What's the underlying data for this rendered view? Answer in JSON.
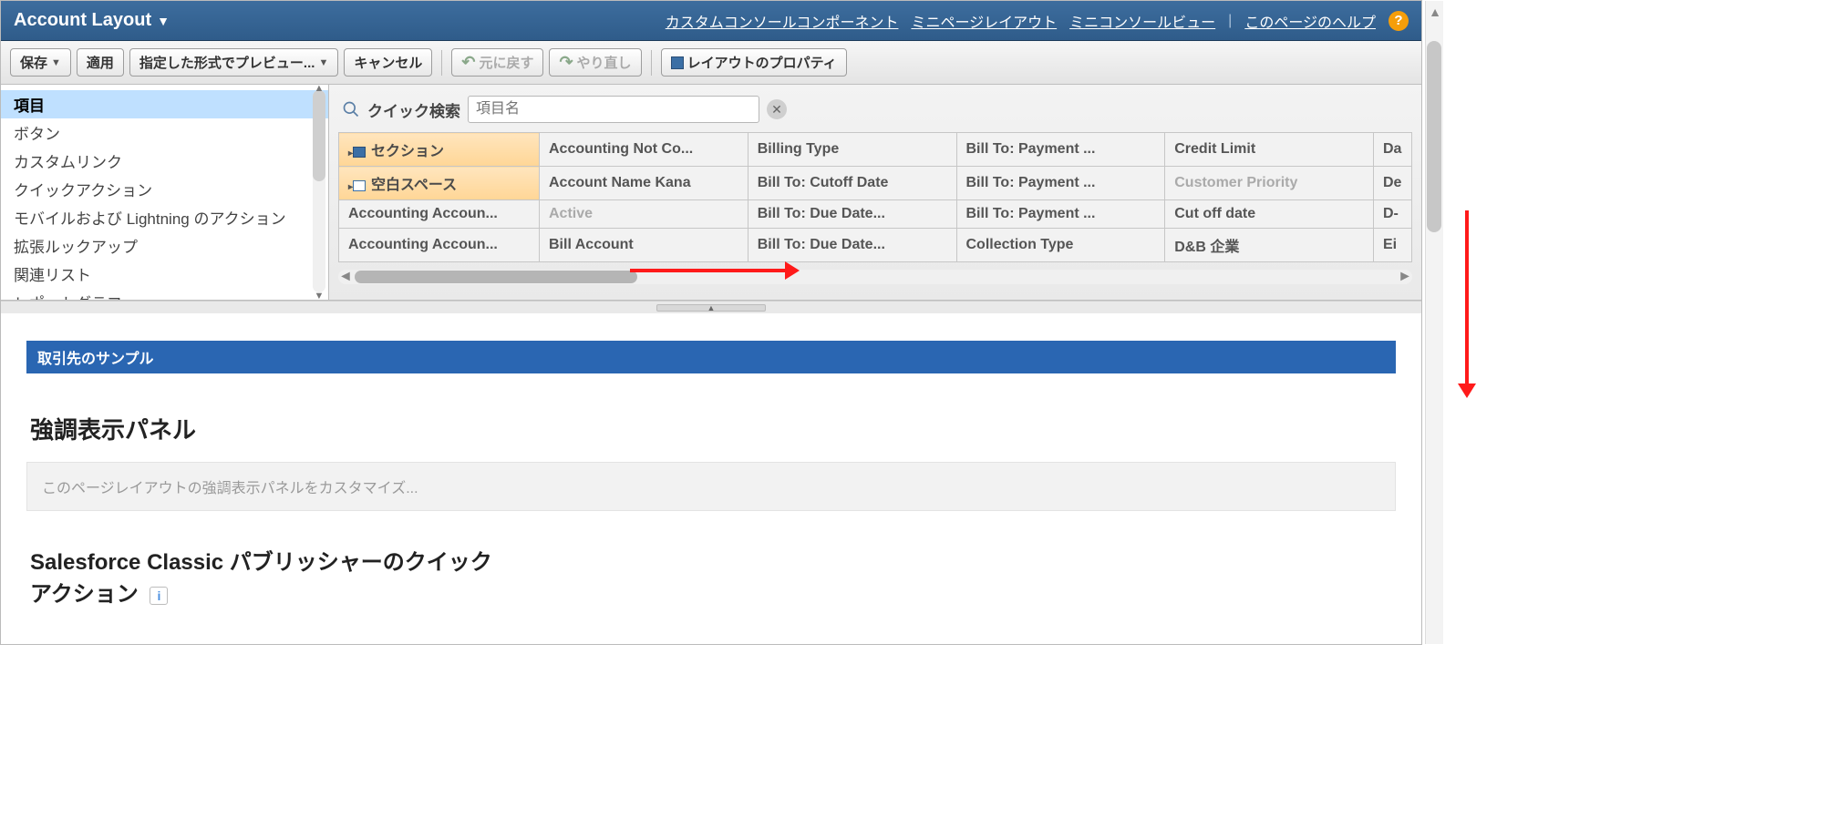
{
  "header": {
    "title": "Account Layout",
    "links": {
      "customConsole": "カスタムコンソールコンポーネント",
      "miniPageLayout": "ミニページレイアウト",
      "miniConsoleView": "ミニコンソールビュー",
      "help": "このページのヘルプ"
    }
  },
  "toolbar": {
    "save": "保存",
    "apply": "適用",
    "previewAs": "指定した形式でプレビュー...",
    "cancel": "キャンセル",
    "undo": "元に戻す",
    "redo": "やり直し",
    "layoutProps": "レイアウトのプロパティ"
  },
  "sidebar": {
    "items": [
      "項目",
      "ボタン",
      "カスタムリンク",
      "クイックアクション",
      "モバイルおよび Lightning のアクション",
      "拡張ルックアップ",
      "関連リスト",
      "レポートグラフ"
    ],
    "selectedIndex": 0
  },
  "search": {
    "label": "クイック検索",
    "placeholder": "項目名"
  },
  "palette": {
    "rows": [
      [
        {
          "label": "セクション",
          "style": "orange",
          "icon": "sec"
        },
        {
          "label": "Accounting Not Co..."
        },
        {
          "label": "Billing Type"
        },
        {
          "label": "Bill To: Payment ..."
        },
        {
          "label": "Credit Limit"
        },
        {
          "label": "Da"
        }
      ],
      [
        {
          "label": "空白スペース",
          "style": "orange",
          "icon": "blank"
        },
        {
          "label": "Account Name Kana"
        },
        {
          "label": "Bill To: Cutoff Date"
        },
        {
          "label": "Bill To: Payment ..."
        },
        {
          "label": "Customer Priority",
          "style": "dim"
        },
        {
          "label": "De"
        }
      ],
      [
        {
          "label": "Accounting Accoun..."
        },
        {
          "label": "Active",
          "style": "dim"
        },
        {
          "label": "Bill To: Due Date..."
        },
        {
          "label": "Bill To: Payment ..."
        },
        {
          "label": "Cut off date"
        },
        {
          "label": "D-"
        }
      ],
      [
        {
          "label": "Accounting Accoun..."
        },
        {
          "label": "Bill Account"
        },
        {
          "label": "Bill To: Due Date..."
        },
        {
          "label": "Collection Type"
        },
        {
          "label": "D&B 企業"
        },
        {
          "label": "Ei"
        }
      ]
    ]
  },
  "preview": {
    "sampleTitle": "取引先のサンプル",
    "highlightPanel": "強調表示パネル",
    "highlightHint": "このページレイアウトの強調表示パネルをカスタマイズ...",
    "classicPublisher": "Salesforce Classic パブリッシャーのクイック",
    "action": "アクション"
  }
}
